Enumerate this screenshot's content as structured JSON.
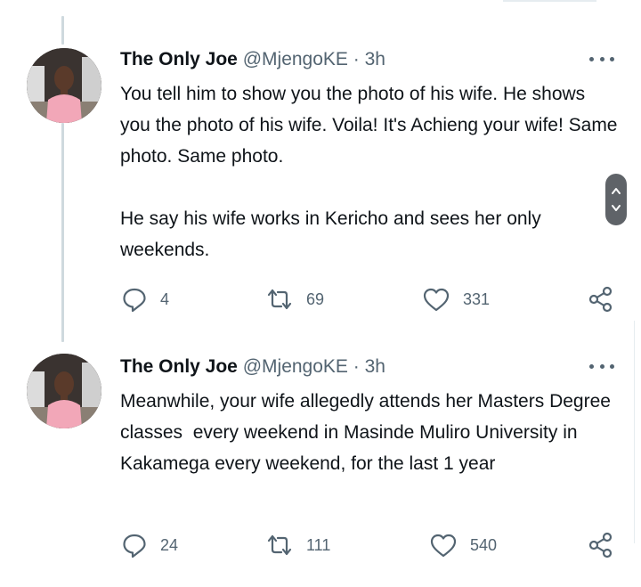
{
  "tweets": [
    {
      "name": "The Only Joe",
      "handle": "@MjengoKE",
      "separator": "·",
      "time": "3h",
      "text": "You tell him to show you the photo of his wife. He shows you the photo of his wife. Voila! It's Achieng your wife! Same photo. Same photo.\n\nHe say his wife works in Kericho and sees her only weekends.",
      "replies": "4",
      "retweets": "69",
      "likes": "331"
    },
    {
      "name": "The Only Joe",
      "handle": "@MjengoKE",
      "separator": "·",
      "time": "3h",
      "text": "Meanwhile, your wife allegedly attends her Masters Degree classes  every weekend in Masinde Muliro University in Kakamega every weekend, for the last 1 year",
      "replies": "24",
      "retweets": "111",
      "likes": "540"
    }
  ],
  "icons": {
    "more": "more-horizontal-icon",
    "reply": "reply-icon",
    "retweet": "retweet-icon",
    "like": "heart-icon",
    "share": "share-icon",
    "scroll": "scroll-up-down-icon"
  },
  "colors": {
    "text": "#0f1419",
    "secondary": "#536471",
    "thread_line": "#cfd9de",
    "avatar_shirt": "#f2a7b8"
  }
}
